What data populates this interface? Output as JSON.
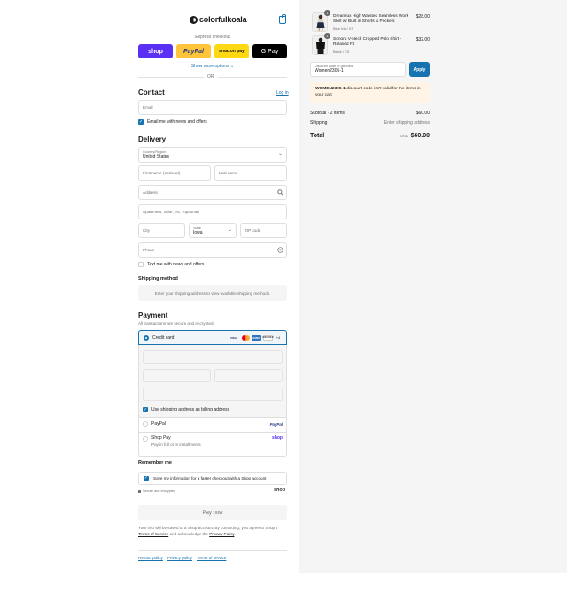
{
  "brand": {
    "name": "colorfulkoala"
  },
  "express": {
    "title": "Express checkout",
    "buttons": {
      "shop": "shop",
      "paypal": "PayPal",
      "amazon": "amazon pay",
      "gpay": "G Pay"
    },
    "more": "Show more options ⌄",
    "or": "OR"
  },
  "contact": {
    "title": "Contact",
    "login": "Log in",
    "email_placeholder": "Email",
    "news_label": "Email me with news and offers"
  },
  "delivery": {
    "title": "Delivery",
    "country_label": "Country/Region",
    "country_value": "United States",
    "first_name": "First name (optional)",
    "last_name": "Last name",
    "address": "Address",
    "apartment": "Apartment, suite, etc. (optional)",
    "city": "City",
    "state_label": "State",
    "state_value": "Iowa",
    "zip": "ZIP code",
    "phone": "Phone",
    "text_label": "Text me with news and offers"
  },
  "shipping": {
    "title": "Shipping method",
    "message": "Enter your shipping address to view available shipping methods."
  },
  "payment": {
    "title": "Payment",
    "subtitle": "All transactions are secure and encrypted.",
    "credit_card": "Credit card",
    "brands": {
      "visa": "VISA",
      "amex": "AMEX",
      "discover": "DISCOVER",
      "more": "+4"
    },
    "billing_label": "Use shipping address as billing address",
    "paypal_label": "PayPal",
    "paypal_logo": "PayPal",
    "shoppay_label": "Shop Pay",
    "shoppay_sub": "Pay in full or in installments",
    "shoppay_logo": "shop"
  },
  "remember": {
    "title": "Remember me",
    "save_label": "Save my information for a faster checkout with a Shop account",
    "secure": "Secure and encrypted",
    "shop_logo": "shop"
  },
  "pay_now": "Pay now",
  "fine_print": {
    "part1": "Your info will be saved to a Shop account. By continuing, you agree to Shop's",
    "terms": "Terms of Service",
    "part2": "and acknowledge the",
    "privacy": "Privacy Policy",
    "end": "."
  },
  "footer": {
    "refund": "Refund policy",
    "privacy": "Privacy policy",
    "terms": "Terms of service"
  },
  "summary": {
    "items": [
      {
        "qty": "1",
        "name": "Dreamlux High Waisted Seamless Work Skirt w/ Built in Shorts & Pockets",
        "variant": "Blue Ink / XS",
        "price": "$28.00"
      },
      {
        "qty": "1",
        "name": "Sonora V-Neck Cropped Polo Shirt - Relaxed Fit",
        "variant": "Black / XS",
        "price": "$32.00"
      }
    ],
    "discount_label": "Discount code or gift card",
    "discount_value": "Women2305-1",
    "apply": "Apply",
    "warning_code": "WOMEN2305-1",
    "warning_text": "discount code isn't valid for the items in your cart",
    "subtotal_label": "Subtotal · 2 items",
    "subtotal_value": "$60.00",
    "shipping_label": "Shipping",
    "shipping_value": "Enter shipping address",
    "total_label": "Total",
    "currency": "USD",
    "total_value": "$60.00"
  },
  "colors": {
    "accent": "#1773b0",
    "shop": "#5a31f4",
    "paypal": "#ffc439",
    "amazon": "#ffd814"
  }
}
